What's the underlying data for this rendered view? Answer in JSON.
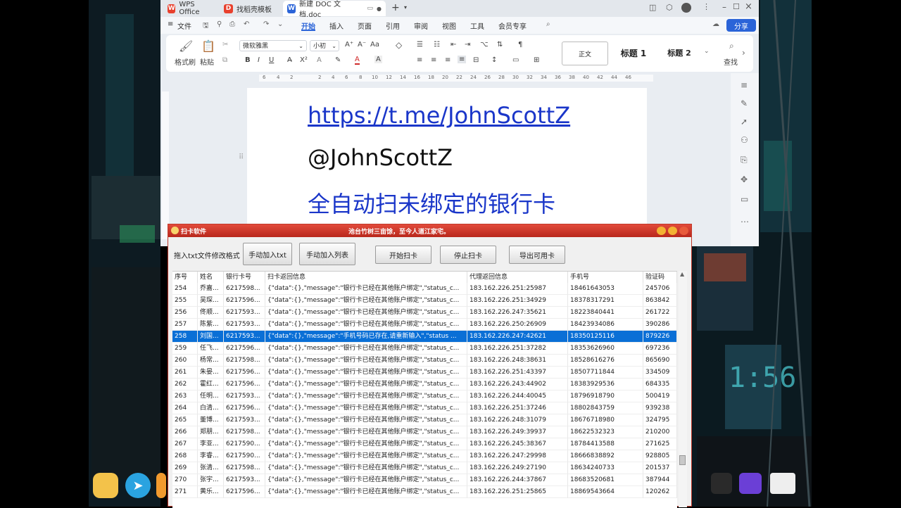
{
  "wps": {
    "tabs": [
      {
        "label": "WPS Office",
        "icon": "wps-logo-icon"
      },
      {
        "label": "找稻壳模板",
        "icon": "docer-icon"
      },
      {
        "label": "新建 DOC 文档.doc",
        "icon": "word-doc-icon"
      }
    ],
    "menu": {
      "file": "文件",
      "items": [
        "开始",
        "插入",
        "页面",
        "引用",
        "审阅",
        "视图",
        "工具",
        "会员专享"
      ],
      "active": "开始",
      "share": "分享"
    },
    "ribbon": {
      "format_painter": "格式刷",
      "paste": "粘贴",
      "font_name": "微软雅黑",
      "font_size": "小初",
      "styles": [
        "正文",
        "标题 1",
        "标题 2"
      ],
      "find": "查找"
    },
    "ruler_ticks": [
      "6",
      "4",
      "2",
      "2",
      "4",
      "6",
      "8",
      "10",
      "12",
      "14",
      "16",
      "18",
      "20",
      "22",
      "24",
      "26",
      "28",
      "30",
      "32",
      "34",
      "36",
      "38",
      "40",
      "42",
      "44",
      "46"
    ],
    "document": {
      "line1": "https://t.me/JohnScottZ",
      "line2": "@JohnScottZ",
      "line3": "全自动扫未绑定的银行卡"
    }
  },
  "scanner": {
    "title": "扫卡软件",
    "subtitle": "池台竹树三亩馀，至今人道江家宅。",
    "hint": "拖入txt文件修改格式",
    "buttons": {
      "add_txt": "手动加入txt",
      "add_list": "手动加入列表",
      "start": "开始扫卡",
      "stop": "停止扫卡",
      "export": "导出可用卡"
    },
    "columns": [
      "序号",
      "姓名",
      "银行卡号",
      "扫卡返回信息",
      "代理返回信息",
      "手机号",
      "验证码"
    ],
    "rows": [
      [
        "254",
        "乔嘉...",
        "6217598...",
        "{\"data\":{},\"message\":\"银行卡已经在其他账户绑定\",\"status_c...",
        "183.162.226.251:25987",
        "18461643053",
        "245706"
      ],
      [
        "255",
        "吴琛...",
        "6217596...",
        "{\"data\":{},\"message\":\"银行卡已经在其他账户绑定\",\"status_c...",
        "183.162.226.251:34929",
        "18378317291",
        "863842"
      ],
      [
        "256",
        "佟顺...",
        "6217593...",
        "{\"data\":{},\"message\":\"银行卡已经在其他账户绑定\",\"status_c...",
        "183.162.226.247:35621",
        "18223840441",
        "261722"
      ],
      [
        "257",
        "陈紫...",
        "6217593...",
        "{\"data\":{},\"message\":\"银行卡已经在其他账户绑定\",\"status_c...",
        "183.162.226.250:26909",
        "18423934086",
        "390286"
      ],
      [
        "258",
        "刘国...",
        "6217593...",
        "{\"data\":{},\"message\":\"手机号码已存在,请重新输入\",\"status ...",
        "183.162.226.247:42621",
        "18350125116",
        "879226"
      ],
      [
        "259",
        "任飞...",
        "6217596...",
        "{\"data\":{},\"message\":\"银行卡已经在其他账户绑定\",\"status_c...",
        "183.162.226.251:37282",
        "18353626960",
        "697236"
      ],
      [
        "260",
        "杨常...",
        "6217598...",
        "{\"data\":{},\"message\":\"银行卡已经在其他账户绑定\",\"status_c...",
        "183.162.226.248:38631",
        "18528616276",
        "865690"
      ],
      [
        "261",
        "朱晏...",
        "6217596...",
        "{\"data\":{},\"message\":\"银行卡已经在其他账户绑定\",\"status_c...",
        "183.162.226.251:43397",
        "18507711844",
        "334509"
      ],
      [
        "262",
        "霍红...",
        "6217596...",
        "{\"data\":{},\"message\":\"银行卡已经在其他账户绑定\",\"status_c...",
        "183.162.226.243:44902",
        "18383929536",
        "684335"
      ],
      [
        "263",
        "任明...",
        "6217593...",
        "{\"data\":{},\"message\":\"银行卡已经在其他账户绑定\",\"status_c...",
        "183.162.226.244:40045",
        "18796918790",
        "500419"
      ],
      [
        "264",
        "白清...",
        "6217596...",
        "{\"data\":{},\"message\":\"银行卡已经在其他账户绑定\",\"status_c...",
        "183.162.226.251:37246",
        "18802843759",
        "939238"
      ],
      [
        "265",
        "董博...",
        "6217593...",
        "{\"data\":{},\"message\":\"银行卡已经在其他账户绑定\",\"status_c...",
        "183.162.226.248:31079",
        "18676718980",
        "324795"
      ],
      [
        "266",
        "郑朋...",
        "6217598...",
        "{\"data\":{},\"message\":\"银行卡已经在其他账户绑定\",\"status_c...",
        "183.162.226.249:39937",
        "18622532323",
        "210200"
      ],
      [
        "267",
        "李亚...",
        "6217590...",
        "{\"data\":{},\"message\":\"银行卡已经在其他账户绑定\",\"status_c...",
        "183.162.226.245:38367",
        "18784413588",
        "271625"
      ],
      [
        "268",
        "李睿...",
        "6217590...",
        "{\"data\":{},\"message\":\"银行卡已经在其他账户绑定\",\"status_c...",
        "183.162.226.247:29998",
        "18666838892",
        "928805"
      ],
      [
        "269",
        "张清...",
        "6217598...",
        "{\"data\":{},\"message\":\"银行卡已经在其他账户绑定\",\"status_c...",
        "183.162.226.249:27190",
        "18634240733",
        "201537"
      ],
      [
        "270",
        "张宇...",
        "6217593...",
        "{\"data\":{},\"message\":\"银行卡已经在其他账户绑定\",\"status_c...",
        "183.162.226.244:37867",
        "18683520681",
        "387944"
      ],
      [
        "271",
        "黄乐...",
        "6217596...",
        "{\"data\":{},\"message\":\"银行卡已经在其他账户绑定\",\"status_c...",
        "183.162.226.251:25865",
        "18869543664",
        "120262"
      ]
    ],
    "selected_row": 4
  },
  "colors": {
    "accent": "#2b64d8",
    "link": "#1a36c9",
    "scanner_title": "#c8321f",
    "selection": "#0a6fd6"
  }
}
